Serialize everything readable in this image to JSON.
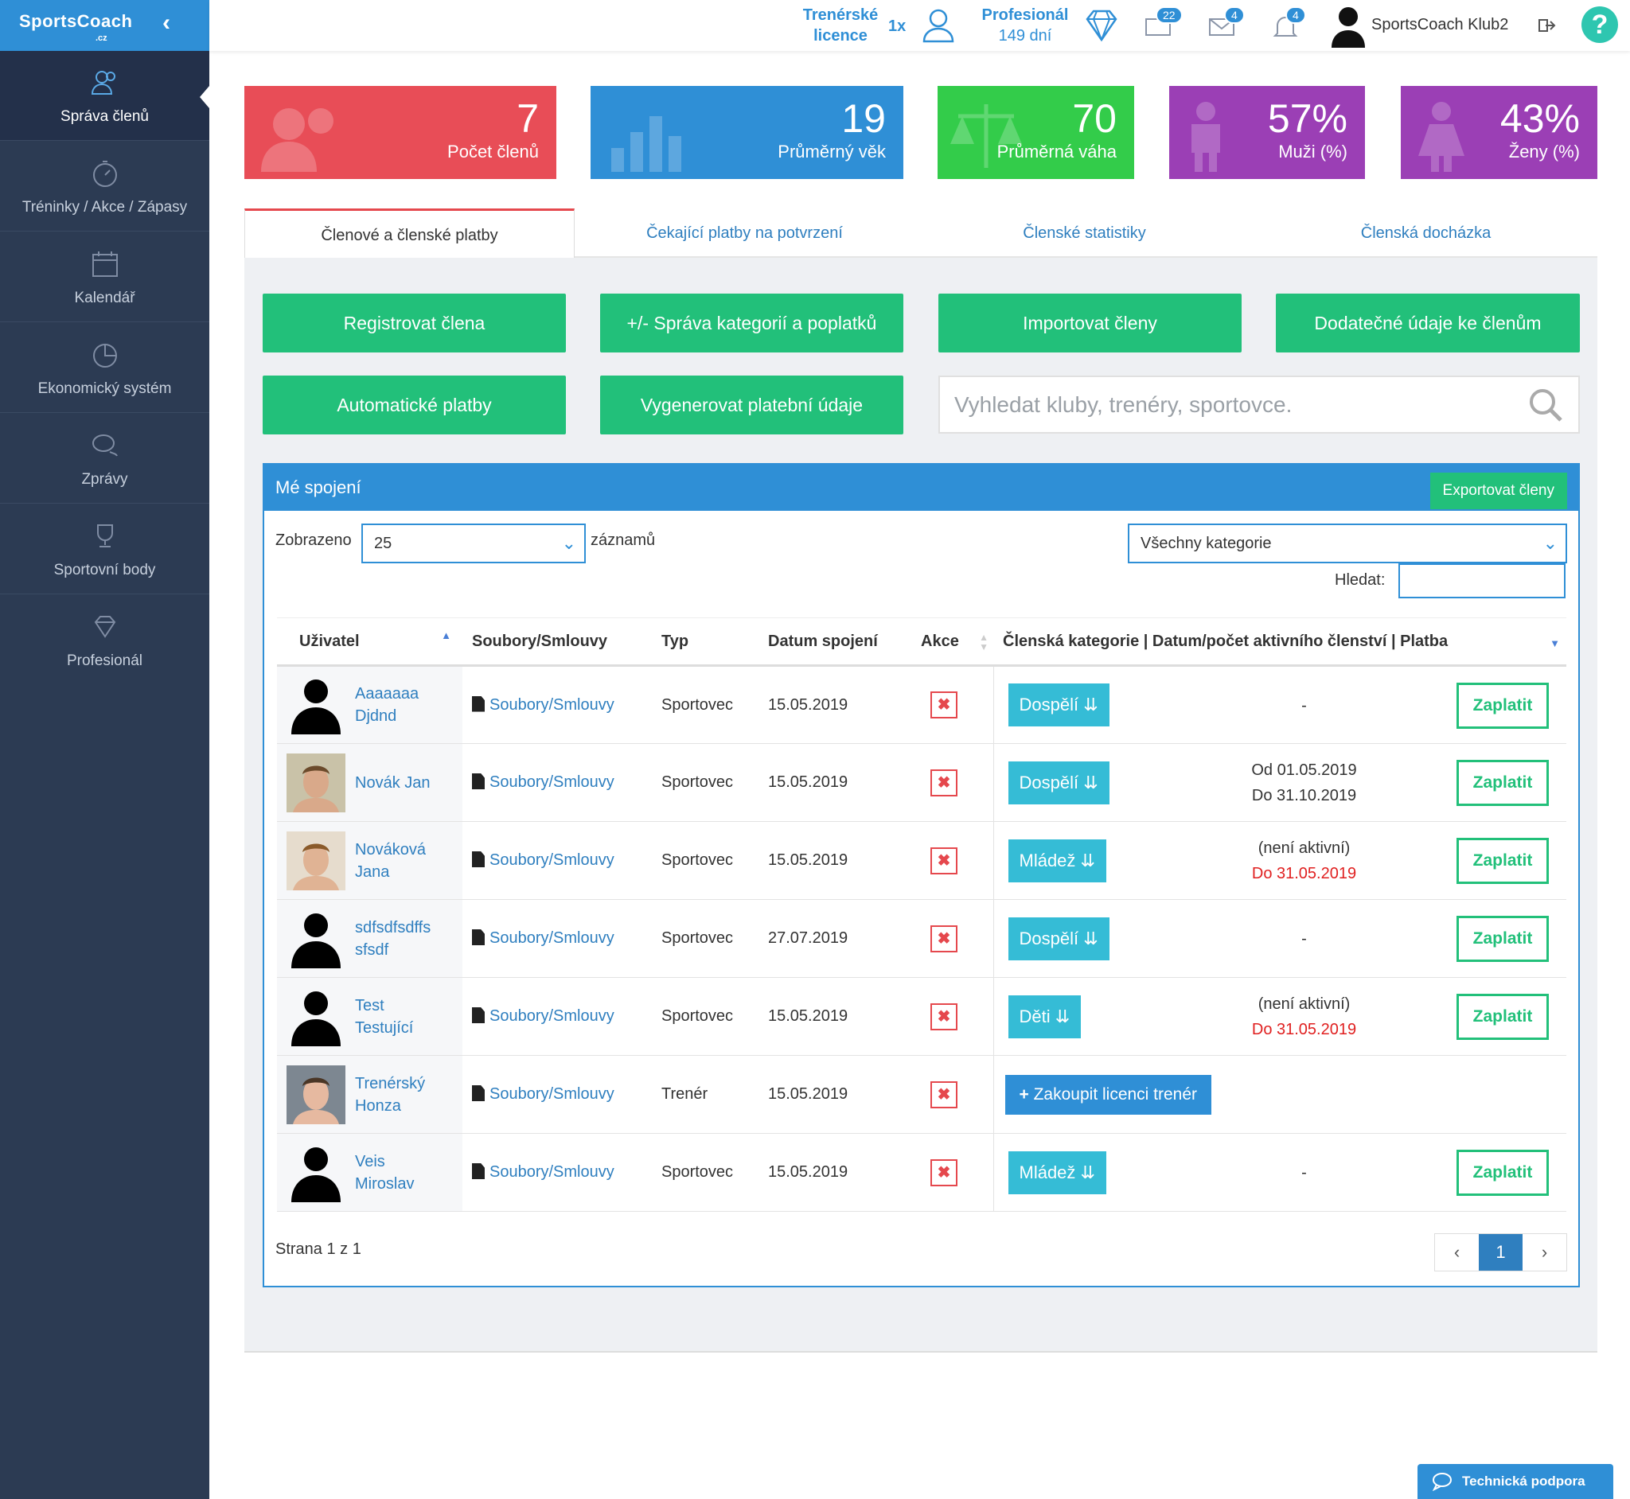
{
  "brand": {
    "name": "SportsCoach",
    "suffix": ".cz"
  },
  "sidebar": {
    "items": [
      {
        "label": "Správa členů",
        "icon": "users-icon"
      },
      {
        "label": "Tréninky / Akce / Zápasy",
        "icon": "stopwatch-icon"
      },
      {
        "label": "Kalendář",
        "icon": "calendar-icon"
      },
      {
        "label": "Ekonomický systém",
        "icon": "pie-chart-icon"
      },
      {
        "label": "Zprávy",
        "icon": "chat-icon"
      },
      {
        "label": "Sportovní body",
        "icon": "trophy-icon"
      },
      {
        "label": "Profesionál",
        "icon": "diamond-icon"
      }
    ]
  },
  "topbar": {
    "licence_label_1": "Trenérské",
    "licence_label_2": "licence",
    "licence_count": "1x",
    "plan_name": "Profesionál",
    "plan_days": "149 dní",
    "messages_badge": "22",
    "mail_badge": "4",
    "notif_badge": "4",
    "user_name": "SportsCoach Klub2",
    "help": "?"
  },
  "stats": [
    {
      "value": "7",
      "label": "Počet členů",
      "color": "#e84d57"
    },
    {
      "value": "19",
      "label": "Průměrný věk",
      "color": "#2f8fd6"
    },
    {
      "value": "70",
      "label": "Průměrná váha",
      "color": "#33cc4a"
    },
    {
      "value": "57%",
      "label": "Muži (%)",
      "color": "#9b3fb5"
    },
    {
      "value": "43%",
      "label": "Ženy (%)",
      "color": "#9b3fb5"
    }
  ],
  "tabs": [
    "Členové a členské platby",
    "Čekající platby na potvrzení",
    "Členské statistiky",
    "Členská docházka"
  ],
  "actions": {
    "register": "Registrovat člena",
    "categories": "+/- Správa kategorií a poplatků",
    "import": "Importovat členy",
    "extra": "Dodatečné údaje ke členům",
    "auto_pay": "Automatické platby",
    "gen_pay": "Vygenerovat platební údaje",
    "search_placeholder": "Vyhledat kluby, trenéry, sportovce."
  },
  "box": {
    "title": "Mé spojení",
    "export": "Exportovat členy",
    "shown_label": "Zobrazeno",
    "page_size": "25",
    "records_label": "záznamů",
    "category_filter": "Všechny kategorie",
    "search_label": "Hledat:"
  },
  "table": {
    "headers": [
      "Uživatel",
      "Soubory/Smlouvy",
      "Typ",
      "Datum spojení",
      "Akce",
      "Členská kategorie | Datum/počet aktivního členství | Platba"
    ],
    "rows": [
      {
        "name1": "Aaaaaaa",
        "name2": "Djdnd",
        "avatar": "silhouette",
        "files": "Soubory/Smlouvy",
        "type": "Sportovec",
        "date": "15.05.2019",
        "category": "Dospělí",
        "period1": "-",
        "period2": "",
        "pay": "Zaplatit"
      },
      {
        "name1": "Novák Jan",
        "name2": "",
        "avatar": "photo-male",
        "files": "Soubory/Smlouvy",
        "type": "Sportovec",
        "date": "15.05.2019",
        "category": "Dospělí",
        "period1": "Od 01.05.2019",
        "period2": "Do 31.10.2019",
        "pay": "Zaplatit"
      },
      {
        "name1": "Nováková",
        "name2": "Jana",
        "avatar": "photo-female",
        "files": "Soubory/Smlouvy",
        "type": "Sportovec",
        "date": "15.05.2019",
        "category": "Mládež",
        "period1": "(není aktivní)",
        "period2": "Do 31.05.2019",
        "pay": "Zaplatit"
      },
      {
        "name1": "sdfsdfsdffs",
        "name2": "sfsdf",
        "avatar": "silhouette",
        "files": "Soubory/Smlouvy",
        "type": "Sportovec",
        "date": "27.07.2019",
        "category": "Dospělí",
        "period1": "-",
        "period2": "",
        "pay": "Zaplatit"
      },
      {
        "name1": "Test",
        "name2": "Testující",
        "avatar": "silhouette",
        "files": "Soubory/Smlouvy",
        "type": "Sportovec",
        "date": "15.05.2019",
        "category": "Děti",
        "period1": "(není aktivní)",
        "period2": "Do 31.05.2019",
        "pay": "Zaplatit"
      },
      {
        "name1": "Trenérský",
        "name2": "Honza",
        "avatar": "photo-male-2",
        "files": "Soubory/Smlouvy",
        "type": "Trenér",
        "date": "15.05.2019",
        "licence": "Zakoupit licenci trenér"
      },
      {
        "name1": "Veis",
        "name2": "Miroslav",
        "avatar": "silhouette",
        "files": "Soubory/Smlouvy",
        "type": "Sportovec",
        "date": "15.05.2019",
        "category": "Mládež",
        "period1": "-",
        "period2": "",
        "pay": "Zaplatit"
      }
    ]
  },
  "pagination": {
    "info": "Strana 1 z 1",
    "prev": "‹",
    "current": "1",
    "next": "›"
  },
  "support": "Technická podpora"
}
